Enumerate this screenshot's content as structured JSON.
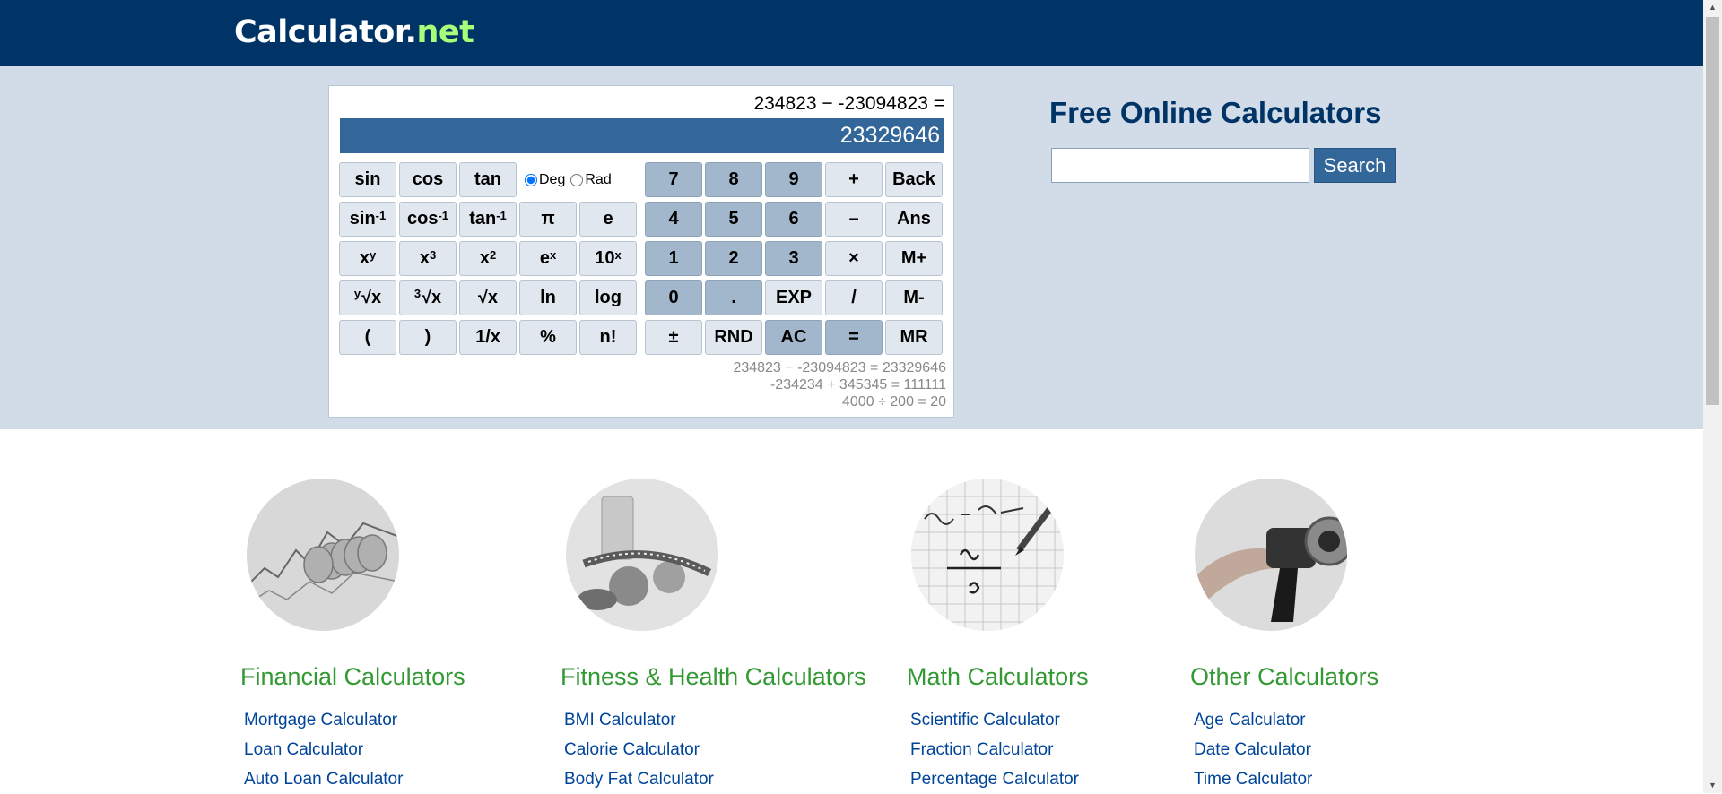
{
  "header": {
    "logo_part1": "Calculator",
    "logo_dot": ".",
    "logo_part2": "net",
    "colors": {
      "background": "#003366",
      "logo_accent": "#a5ff7a"
    }
  },
  "calculator": {
    "expression": "234823 − -23094823 =",
    "display": "23329646",
    "angle_mode": {
      "deg_label": "Deg",
      "rad_label": "Rad",
      "selected": "Deg"
    },
    "buttons": {
      "sin": "sin",
      "cos": "cos",
      "tan": "tan",
      "asin": "sin",
      "acos": "cos",
      "atan": "tan",
      "inverse_sup": "-1",
      "pi": "π",
      "e": "e",
      "xy_base": "x",
      "xy_sup": "y",
      "x3_base": "x",
      "x3_sup": "3",
      "x2_base": "x",
      "x2_sup": "2",
      "ex_base": "e",
      "ex_sup": "x",
      "tenx_base": "10",
      "tenx_sup": "x",
      "yroot_pre": "y",
      "yroot_main": "√x",
      "cuberoot_pre": "3",
      "cuberoot_main": "√x",
      "sqrt": "√x",
      "ln": "ln",
      "log": "log",
      "lparen": "(",
      "rparen": ")",
      "reciprocal": "1/x",
      "percent": "%",
      "factorial": "n!",
      "d7": "7",
      "d8": "8",
      "d9": "9",
      "d4": "4",
      "d5": "5",
      "d6": "6",
      "d1": "1",
      "d2": "2",
      "d3": "3",
      "d0": "0",
      "dot": ".",
      "plus": "+",
      "minus": "–",
      "times": "×",
      "divide": "/",
      "back": "Back",
      "ans": "Ans",
      "mplus": "M+",
      "mminus": "M-",
      "mr": "MR",
      "exp": "EXP",
      "plusminus": "±",
      "rnd": "RND",
      "ac": "AC",
      "equals": "="
    },
    "history": [
      "234823 − -23094823 = 23329646",
      "-234234 + 345345 = 111111",
      "4000 ÷ 200 = 20"
    ]
  },
  "search": {
    "title": "Free Online Calculators",
    "input_value": "",
    "button_label": "Search"
  },
  "categories": [
    {
      "title": "Financial Calculators",
      "icon": "coins-chart-image",
      "links": [
        "Mortgage Calculator",
        "Loan Calculator",
        "Auto Loan Calculator"
      ]
    },
    {
      "title": "Fitness & Health Calculators",
      "icon": "vegetables-tape-image",
      "links": [
        "BMI Calculator",
        "Calorie Calculator",
        "Body Fat Calculator"
      ]
    },
    {
      "title": "Math Calculators",
      "icon": "math-equation-image",
      "links": [
        "Scientific Calculator",
        "Fraction Calculator",
        "Percentage Calculator"
      ]
    },
    {
      "title": "Other Calculators",
      "icon": "fuel-pump-image",
      "links": [
        "Age Calculator",
        "Date Calculator",
        "Time Calculator"
      ]
    }
  ]
}
